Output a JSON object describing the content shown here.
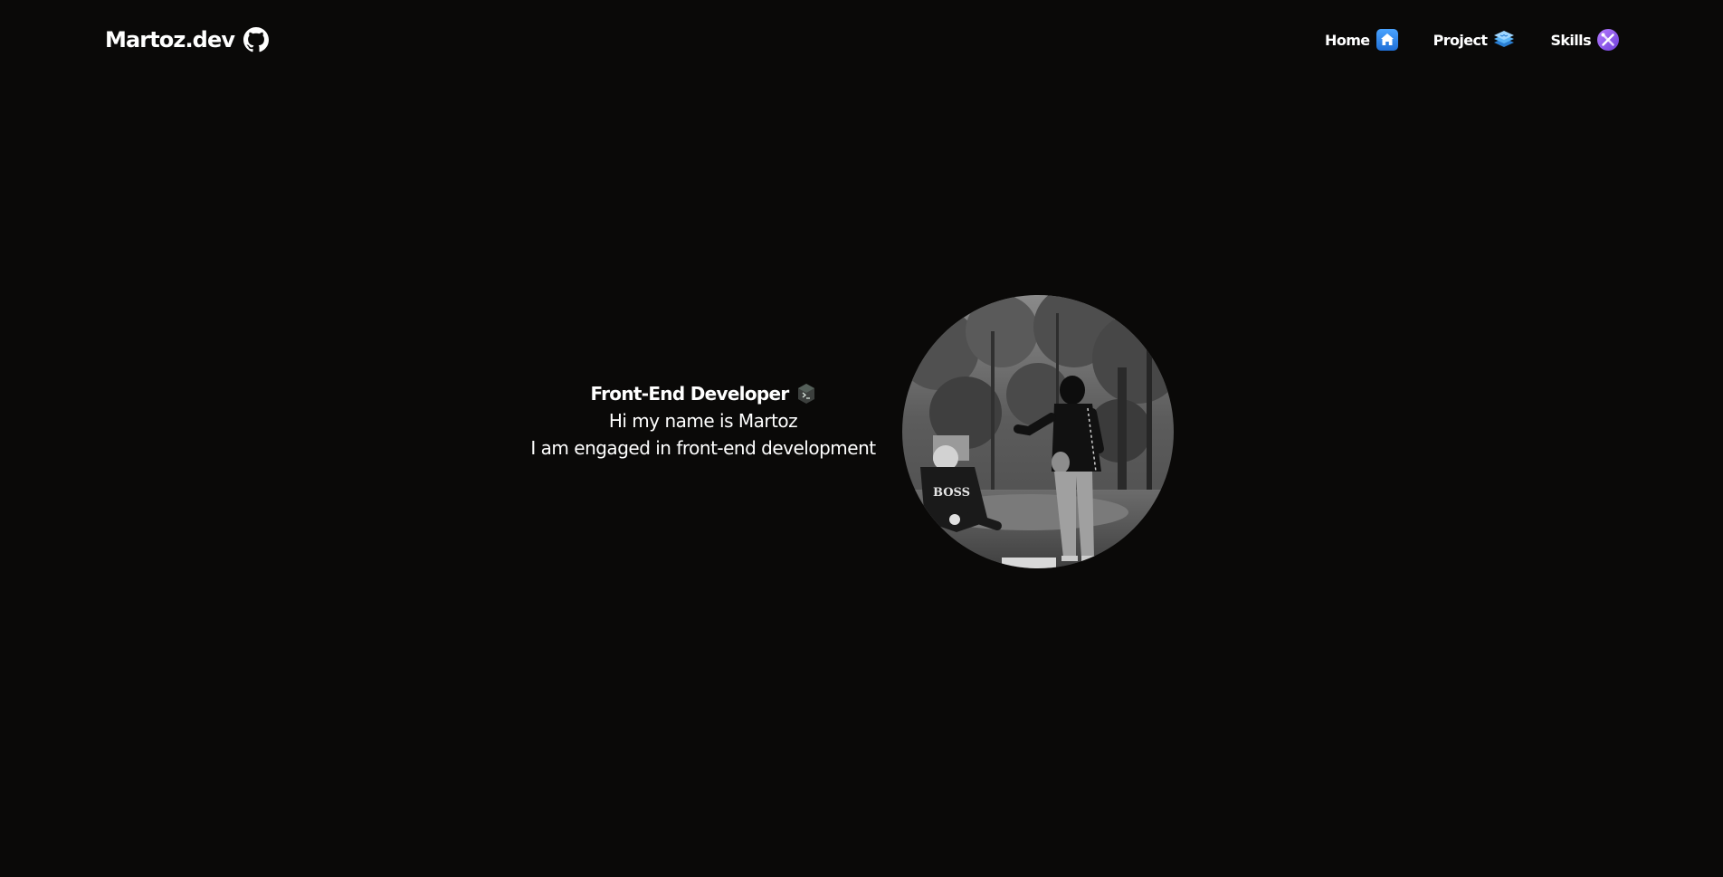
{
  "header": {
    "brand": "Martoz.dev",
    "brand_icon": "github-icon",
    "nav": [
      {
        "label": "Home",
        "icon": "home-icon",
        "accent": "#2f8cf0"
      },
      {
        "label": "Project",
        "icon": "layers-icon",
        "accent": "#3aa0f5"
      },
      {
        "label": "Skills",
        "icon": "tools-icon",
        "accent": "#8b5cf6"
      }
    ]
  },
  "hero": {
    "title": "Front-End Developer",
    "title_icon": "terminal-icon",
    "line1": "Hi my name is Martoz",
    "line2": "I am engaged in front-end development",
    "avatar": "profile-photo"
  },
  "colors": {
    "background": "#0a0908",
    "text": "#ffffff"
  }
}
